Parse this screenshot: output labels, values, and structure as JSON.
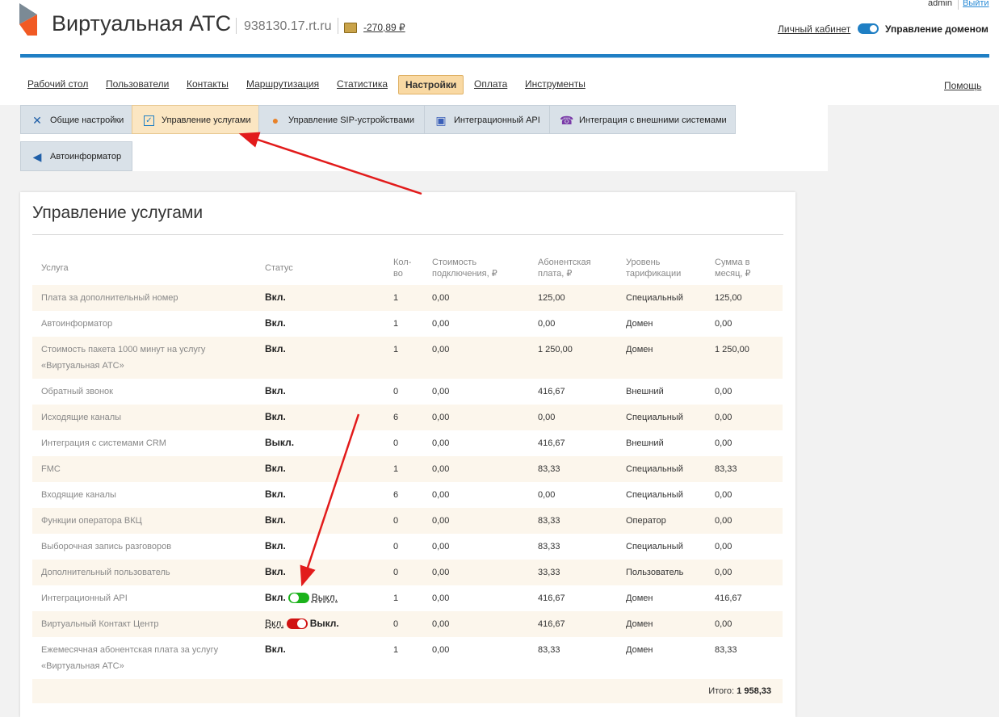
{
  "header": {
    "title": "Виртуальная АТС",
    "domain": "938130.17.rt.ru",
    "balance": "-270,89 ₽",
    "user": "admin",
    "logout": "Выйти",
    "cabinet": "Личный кабинет",
    "domain_mgmt": "Управление доменом"
  },
  "nav": {
    "items": [
      {
        "label": "Рабочий стол"
      },
      {
        "label": "Пользователи"
      },
      {
        "label": "Контакты"
      },
      {
        "label": "Маршрутизация"
      },
      {
        "label": "Статистика"
      },
      {
        "label": "Настройки",
        "active": true
      },
      {
        "label": "Оплата"
      },
      {
        "label": "Инструменты"
      }
    ],
    "help": "Помощь"
  },
  "subtabs": [
    {
      "label": "Общие настройки",
      "icon": "tools-icon"
    },
    {
      "label": "Управление услугами",
      "icon": "checkbox-icon",
      "active": true
    },
    {
      "label": "Управление SIP-устройствами",
      "icon": "sip-device-icon"
    },
    {
      "label": "Интеграционный API",
      "icon": "api-icon"
    },
    {
      "label": "Интеграция с внешними системами",
      "icon": "phone-icon"
    },
    {
      "label": "Автоинформатор",
      "icon": "megaphone-icon"
    }
  ],
  "panel": {
    "title": "Управление услугами",
    "headers": {
      "service": "Услуга",
      "status": "Статус",
      "qty": "Кол-во",
      "connect": "Стоимость подключения, ₽",
      "fee": "Абонентская плата, ₽",
      "level": "Уровень тарификации",
      "sum": "Сумма в месяц, ₽"
    },
    "rows": [
      {
        "service": "Плата за дополнительный номер",
        "status": "Вкл.",
        "qty": "1",
        "connect": "0,00",
        "fee": "125,00",
        "level": "Специальный",
        "sum": "125,00"
      },
      {
        "service": "Автоинформатор",
        "status": "Вкл.",
        "qty": "1",
        "connect": "0,00",
        "fee": "0,00",
        "level": "Домен",
        "sum": "0,00"
      },
      {
        "service": "Стоимость пакета 1000 минут на услугу «Виртуальная АТС»",
        "status": "Вкл.",
        "qty": "1",
        "connect": "0,00",
        "fee": "1 250,00",
        "level": "Домен",
        "sum": "1 250,00"
      },
      {
        "service": "Обратный звонок",
        "status": "Вкл.",
        "qty": "0",
        "connect": "0,00",
        "fee": "416,67",
        "level": "Внешний",
        "sum": "0,00"
      },
      {
        "service": "Исходящие каналы",
        "status": "Вкл.",
        "qty": "6",
        "connect": "0,00",
        "fee": "0,00",
        "level": "Специальный",
        "sum": "0,00"
      },
      {
        "service": "Интеграция с системами CRM",
        "status": "Выкл.",
        "qty": "0",
        "connect": "0,00",
        "fee": "416,67",
        "level": "Внешний",
        "sum": "0,00"
      },
      {
        "service": "FMC",
        "status": "Вкл.",
        "qty": "1",
        "connect": "0,00",
        "fee": "83,33",
        "level": "Специальный",
        "sum": "83,33"
      },
      {
        "service": "Входящие каналы",
        "status": "Вкл.",
        "qty": "6",
        "connect": "0,00",
        "fee": "0,00",
        "level": "Специальный",
        "sum": "0,00"
      },
      {
        "service": "Функции оператора ВКЦ",
        "status": "Вкл.",
        "qty": "0",
        "connect": "0,00",
        "fee": "83,33",
        "level": "Оператор",
        "sum": "0,00"
      },
      {
        "service": "Выборочная запись разговоров",
        "status": "Вкл.",
        "qty": "0",
        "connect": "0,00",
        "fee": "83,33",
        "level": "Специальный",
        "sum": "0,00"
      },
      {
        "service": "Дополнительный пользователь",
        "status": "Вкл.",
        "qty": "0",
        "connect": "0,00",
        "fee": "33,33",
        "level": "Пользователь",
        "sum": "0,00"
      },
      {
        "service": "Интеграционный API",
        "status_on": "Вкл.",
        "status_off": "Выкл.",
        "toggle": "on",
        "qty": "1",
        "connect": "0,00",
        "fee": "416,67",
        "level": "Домен",
        "sum": "416,67"
      },
      {
        "service": "Виртуальный Контакт Центр",
        "status_on": "Вкл.",
        "status_off": "Выкл.",
        "toggle": "off",
        "qty": "0",
        "connect": "0,00",
        "fee": "416,67",
        "level": "Домен",
        "sum": "0,00"
      },
      {
        "service": "Ежемесячная абонентская плата за услугу «Виртуальная АТС»",
        "status": "Вкл.",
        "qty": "1",
        "connect": "0,00",
        "fee": "83,33",
        "level": "Домен",
        "sum": "83,33"
      }
    ],
    "total_label": "Итого:",
    "total_value": "1 958,33"
  }
}
